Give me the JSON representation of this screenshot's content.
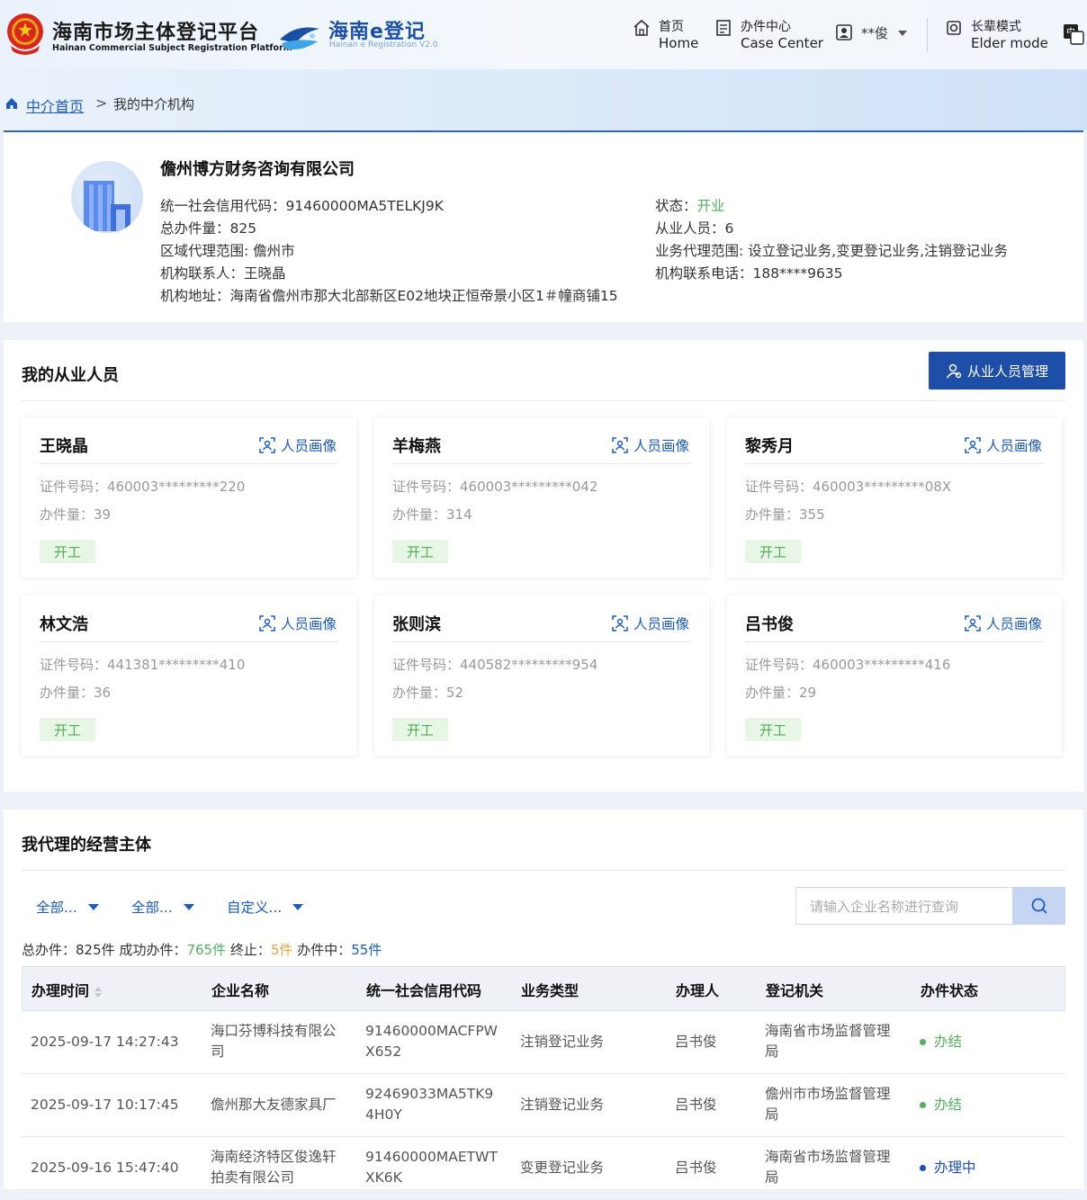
{
  "header": {
    "brand_cn": "海南市场主体登记平台",
    "brand_en": "Hainan Commercial Subject Registration Platform",
    "ereg_title": "海南e登记",
    "ereg_sub": "Hainan e Registration V2.0",
    "nav": [
      {
        "cn": "首页",
        "en": "Home",
        "icon": "home-icon"
      },
      {
        "cn": "办件中心",
        "en": "Case Center",
        "icon": "document-icon"
      },
      {
        "cn": "长辈模式",
        "en": "Elder mode",
        "icon": "elder-mode-icon"
      }
    ],
    "user": "**俊",
    "lang_icon": "language-switch-icon"
  },
  "breadcrumb": {
    "home": "中介首页",
    "separator": ">",
    "current": "我的中介机构"
  },
  "org": {
    "name": "儋州博方财务咨询有限公司",
    "credit_code": "统一社会信用代码：91460000MA5TELKJ9K",
    "total_cases": "总办件量：825",
    "region": "区域代理范围: 儋州市",
    "contact": "机构联系人：王晓晶",
    "address": "机构地址：海南省儋州市那大北部新区E02地块正恒帝景小区1＃幢商铺15",
    "status_label": "状态：",
    "status_value": "开业",
    "staff_count": "从业人员：6",
    "business_scope": "业务代理范围: 设立登记业务,变更登记业务,注销登记业务",
    "phone": "机构联系电话：188****9635"
  },
  "staff_section": {
    "title": "我的从业人员",
    "manage_button": "从业人员管理",
    "profile_label": "人员画像",
    "members": [
      {
        "name": "王晓晶",
        "id": "证件号码：460003*********220",
        "count": "办件量：39",
        "status": "开工"
      },
      {
        "name": "羊梅燕",
        "id": "证件号码：460003*********042",
        "count": "办件量：314",
        "status": "开工"
      },
      {
        "name": "黎秀月",
        "id": "证件号码：460003*********08X",
        "count": "办件量：355",
        "status": "开工"
      },
      {
        "name": "林文浩",
        "id": "证件号码：441381*********410",
        "count": "办件量：36",
        "status": "开工"
      },
      {
        "name": "张则滨",
        "id": "证件号码：440582*********954",
        "count": "办件量：52",
        "status": "开工"
      },
      {
        "name": "吕书俊",
        "id": "证件号码：460003*********416",
        "count": "办件量：29",
        "status": "开工"
      }
    ]
  },
  "agency_section": {
    "title": "我代理的经营主体",
    "filters": [
      "全部...",
      "全部...",
      "自定义..."
    ],
    "search_placeholder": "请输入企业名称进行查询",
    "summary": {
      "total_label": "总办件：",
      "total_value": "825件",
      "success_label": "成功办件：",
      "success_value": "765件",
      "terminated_label": "终止：",
      "terminated_value": "5件",
      "in_progress_label": "办件中：",
      "in_progress_value": "55件"
    },
    "columns": [
      "办理时间",
      "企业名称",
      "统一社会信用代码",
      "业务类型",
      "办理人",
      "登记机关",
      "办件状态"
    ],
    "rows": [
      {
        "time": "2025-09-17 14:27:43",
        "company": "海口芬博科技有限公司",
        "code": "91460000MACFPWX652",
        "type": "注销登记业务",
        "handler": "吕书俊",
        "authority": "海南省市场监督管理局",
        "status": "办结",
        "status_color": "#52b05c"
      },
      {
        "time": "2025-09-17 10:17:45",
        "company": "儋州那大友德家具厂",
        "code": "92469033MA5TK94H0Y",
        "type": "注销登记业务",
        "handler": "吕书俊",
        "authority": "儋州市市场监督管理局",
        "status": "办结",
        "status_color": "#52b05c"
      },
      {
        "time": "2025-09-16 15:47:40",
        "company": "海南经济特区俊逸轩拍卖有限公司",
        "code": "91460000MAETWTXK6K",
        "type": "变更登记业务",
        "handler": "吕书俊",
        "authority": "海南省市场监督管理局",
        "status": "办理中",
        "status_color": "#1a4fc0"
      }
    ]
  }
}
